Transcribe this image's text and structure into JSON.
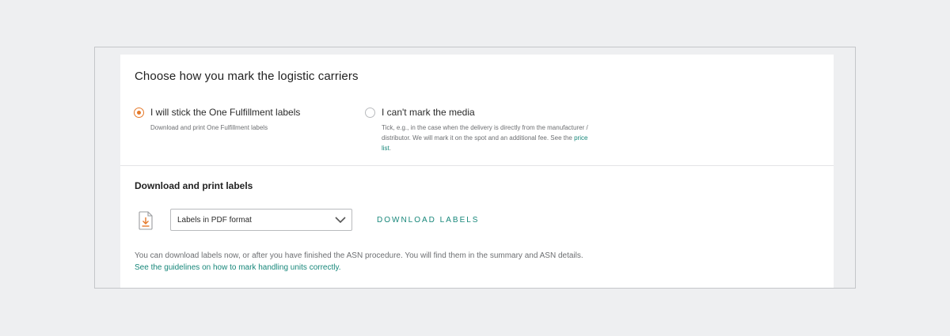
{
  "marking": {
    "title": "Choose how you mark the logistic carriers",
    "options": [
      {
        "label": "I will stick the One Fulfillment labels",
        "description": "Download and print One Fulfillment labels",
        "selected": true
      },
      {
        "label": "I can't mark the media",
        "description_before_link": "Tick, e.g., in the case when the delivery is directly from the manufacturer / distributor. We will mark it on the spot and an additional fee. See the ",
        "link_text": "price list",
        "description_after_link": ".",
        "selected": false
      }
    ]
  },
  "labels": {
    "title": "Download and print labels",
    "format_select_value": "Labels in PDF format",
    "download_button": "DOWNLOAD LABELS",
    "note": "You can download labels now, or after you have finished the ASN procedure. You will find them in the summary and ASN details.",
    "guidelines_link": "See the guidelines on how to mark handling units correctly."
  },
  "colors": {
    "accent_orange": "#e5792a",
    "link_teal": "#17877a",
    "background": "#eeeff1"
  },
  "icons": {
    "file_download": "pdf-download-icon",
    "dropdown": "chevron-down-icon"
  }
}
